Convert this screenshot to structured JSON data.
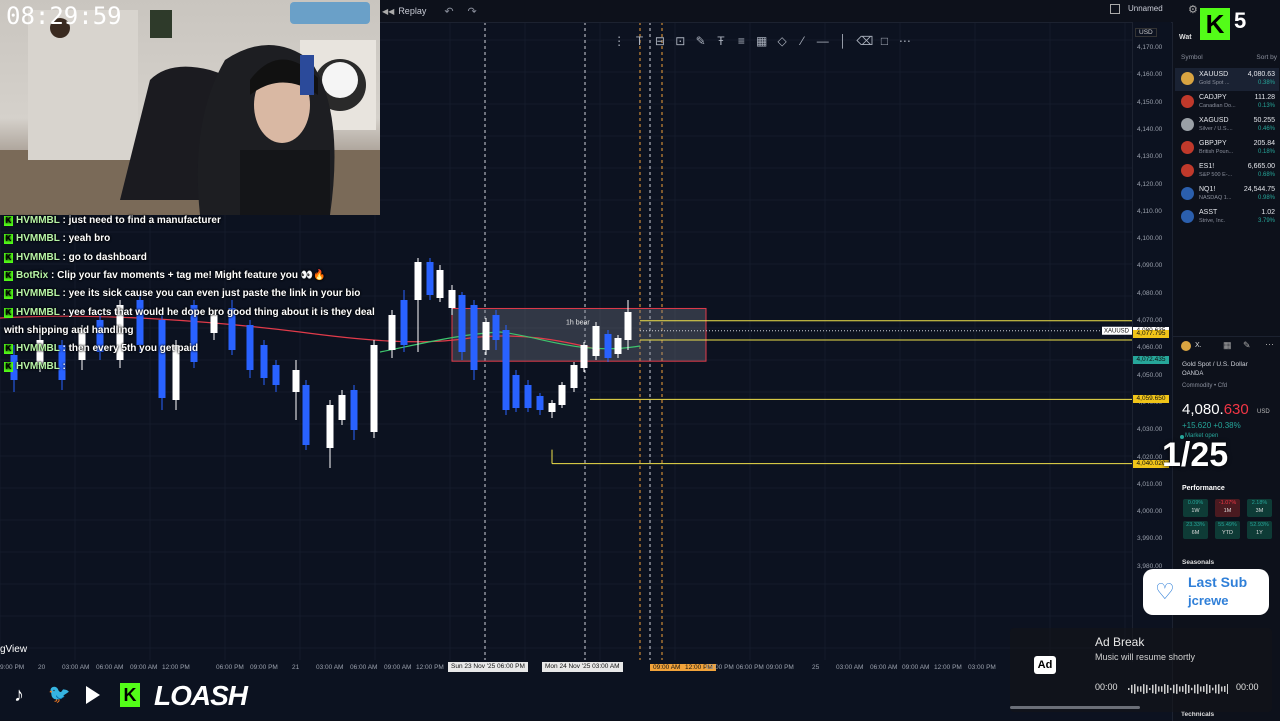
{
  "stream": {
    "clock": "08:29:59",
    "sub_goal": "1/25",
    "kick_count": "5",
    "kick_logo": "K",
    "brand": "LOASH",
    "last_sub": {
      "title": "Last Sub",
      "name": "jcrewe"
    },
    "ad_break": {
      "title": "Ad Break",
      "subtitle": "Music will resume shortly",
      "elapsed": "00:00",
      "remaining": "00:00",
      "badge": "Ad"
    },
    "chat": [
      {
        "user": "HVMMBL",
        "text": ": just need to find a manufacturer"
      },
      {
        "user": "HVMMBL",
        "text": ": yeah bro"
      },
      {
        "user": "HVMMBL",
        "text": ": go to dashboard"
      },
      {
        "user": "BotRix",
        "text": ": Clip your fav moments + tag me! Might feature you 👀🔥"
      },
      {
        "user": "HVMMBL",
        "text": ": yee its sick cause you can even just paste the link in your bio"
      },
      {
        "user": "HVMMBL",
        "text": ": yee facts that would he dope bro good thing about it is they deal"
      },
      {
        "user": "",
        "text": "with shipping and handling"
      },
      {
        "user": "HVMMBL",
        "text": ": then every 5th you get paid"
      },
      {
        "user": "HVMMBL",
        "text": ":"
      }
    ],
    "gview_label": "gView"
  },
  "tradingview": {
    "replay_label": "Replay",
    "layout_name": "Unnamed",
    "currency_selector": "USD",
    "watchlist": {
      "title": "Wat",
      "col_symbol": "Symbol",
      "col_sort": "Sort by",
      "items": [
        {
          "symbol": "XAUUSD",
          "desc": "Gold Spot ...",
          "last": "4,080.63",
          "chg": "0.38%",
          "chg_color": "#26a69a",
          "icon_color": "#d9a441"
        },
        {
          "symbol": "CADJPY",
          "desc": "Canadian Do...",
          "last": "111.28",
          "chg": "0.13%",
          "chg_color": "#26a69a",
          "icon_color": "#c0392b"
        },
        {
          "symbol": "XAGUSD",
          "desc": "Silver / U.S....",
          "last": "50.255",
          "chg": "0.46%",
          "chg_color": "#26a69a",
          "icon_color": "#9aa0a6"
        },
        {
          "symbol": "GBPJPY",
          "desc": "British Poun...",
          "last": "205.84",
          "chg": "0.18%",
          "chg_color": "#26a69a",
          "icon_color": "#c0392b"
        },
        {
          "symbol": "ES1!",
          "desc": "S&P 500 E-...",
          "last": "6,665.00",
          "chg": "0.68%",
          "chg_color": "#26a69a",
          "icon_color": "#c0392b"
        },
        {
          "symbol": "NQ1!",
          "desc": "NASDAQ 1...",
          "last": "24,544.75",
          "chg": "0.98%",
          "chg_color": "#26a69a",
          "icon_color": "#2b5fad"
        },
        {
          "symbol": "ASST",
          "desc": "Strive, Inc.",
          "last": "1.02",
          "chg": "3.79%",
          "chg_color": "#26a69a",
          "icon_color": "#2b5fad"
        }
      ]
    },
    "detail": {
      "name": "Gold Spot / U.S. Dollar",
      "exchange": "OANDA",
      "type": "Commodity • Cfd",
      "price_main": "4,080.",
      "price_frac": "630",
      "currency": "USD",
      "change": "+15.620 +0.38%",
      "status": "Market open",
      "performance_title": "Performance",
      "performance": [
        {
          "pct": "0.09%",
          "period": "1W",
          "color": "#0e3b36",
          "text": "#26a69a"
        },
        {
          "pct": "-1.07%",
          "period": "1M",
          "color": "#4a1a20",
          "text": "#f23645"
        },
        {
          "pct": "2.18%",
          "period": "3M",
          "color": "#0e3b36",
          "text": "#26a69a"
        },
        {
          "pct": "23.33%",
          "period": "6M",
          "color": "#0e3b36",
          "text": "#26a69a"
        },
        {
          "pct": "55.49%",
          "period": "YTD",
          "color": "#0e3b36",
          "text": "#26a69a"
        },
        {
          "pct": "52.93%",
          "period": "1Y",
          "color": "#0e3b36",
          "text": "#26a69a"
        }
      ],
      "seasonals_title": "Seasonals",
      "technicals_title": "Technicals"
    },
    "price_axis": [
      "4,170.00",
      "4,160.00",
      "4,150.00",
      "4,140.00",
      "4,130.00",
      "4,120.00",
      "4,110.00",
      "4,100.00",
      "4,090.00",
      "4,080.00",
      "4,070.00",
      "4,060.00",
      "4,050.00",
      "4,040.00",
      "4,030.00",
      "4,020.00",
      "4,010.00",
      "4,000.00",
      "3,990.00",
      "3,980.00"
    ],
    "price_tags": [
      {
        "label": "4,080.635",
        "bg": "#ffffff",
        "value": 4080.635
      },
      {
        "label": "4,077.795",
        "bg": "#f0c419",
        "value": 4077.795
      },
      {
        "label": "4,072.435",
        "bg": "#26a69a",
        "value": 4072.435
      },
      {
        "label": "4,059.650",
        "bg": "#f0c419",
        "value": 4059.65
      },
      {
        "label": "4,040.020",
        "bg": "#f0c419",
        "value": 4040.02
      }
    ],
    "time_axis": [
      {
        "label": "9:00 PM"
      },
      {
        "label": "20"
      },
      {
        "label": "03:00 AM"
      },
      {
        "label": "06:00 AM"
      },
      {
        "label": "09:00 AM"
      },
      {
        "label": "12:00 PM"
      },
      {
        "label": "06:00 PM"
      },
      {
        "label": "09:00 PM"
      },
      {
        "label": "21"
      },
      {
        "label": "03:00 AM"
      },
      {
        "label": "06:00 AM"
      },
      {
        "label": "09:00 AM"
      },
      {
        "label": "12:00 PM"
      },
      {
        "label": "Sun 23 Nov '25  06:00 PM"
      },
      {
        "label": "Mon 24 Nov '25  03:00 AM"
      },
      {
        "label": "09:00 AM"
      },
      {
        "label": "12:00 PM"
      },
      {
        "label": "03:00 PM"
      },
      {
        "label": "06:00 PM"
      },
      {
        "label": "09:00 PM"
      },
      {
        "label": "25"
      },
      {
        "label": "03:00 AM"
      },
      {
        "label": "06:00 AM"
      },
      {
        "label": "09:00 AM"
      },
      {
        "label": "12:00 PM"
      },
      {
        "label": "03:00 PM"
      }
    ],
    "zone_label": "1h bear",
    "symbol_tag": "XAUUSD",
    "chart_data": {
      "type": "candlestick",
      "ylim": [
        3980,
        4175
      ],
      "levels": [
        4080.635,
        4077.795,
        4059.65,
        4040.02
      ],
      "zone": {
        "from": 4075,
        "to": 4085
      }
    }
  },
  "colors": {
    "bg": "#0c1220",
    "up_candle": "#ffffff",
    "down_candle": "#2962ff",
    "level_line": "#f0e14a",
    "accent_green": "#53fc18"
  }
}
